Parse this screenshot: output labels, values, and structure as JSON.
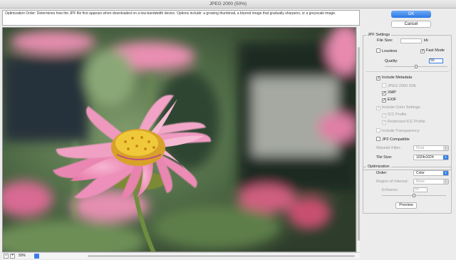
{
  "window": {
    "title": "JPEG 2000 (50%)"
  },
  "hint": "Optimization Order: Determines how the JPF file first appears when downloaded on a low-bandwidth device. Options include: a growing thumbnail, a blurred image that gradually sharpens, or a greyscale image.",
  "preview": {
    "image_description_icon": "flower-photo-icon"
  },
  "bottombar": {
    "zoom_out": "−",
    "zoom_in": "+",
    "zoom": "50%"
  },
  "buttons": {
    "ok": "OK",
    "cancel": "Cancel",
    "preview": "Preview"
  },
  "jpf": {
    "legend": "JPF Settings",
    "file_size_label": "File Size:",
    "file_size_unit": "kb",
    "file_size_value": "",
    "lossless": {
      "label": "Lossless",
      "checked": false
    },
    "fast_mode": {
      "label": "Fast Mode",
      "checked": true
    },
    "quality_label": "Quality:",
    "quality_value": "50",
    "quality_fraction": 0.5,
    "include_metadata": {
      "label": "Include Metadata",
      "checked": true
    },
    "jpeg2000_xml": {
      "label": "JPEG 2000 XML",
      "checked": false
    },
    "xmp": {
      "label": "XMP",
      "checked": true
    },
    "exif": {
      "label": "EXIF",
      "checked": true
    },
    "include_color": {
      "label": "Include Color Settings",
      "checked": true
    },
    "icc_profile": {
      "label": "ICC Profile",
      "checked": true
    },
    "restricted_icc": {
      "label": "Restricted ICC Profile",
      "checked": true
    },
    "include_transparency": {
      "label": "Include Transparency",
      "checked": false
    },
    "jp2_compatible": {
      "label": "JP2 Compatible",
      "checked": false
    },
    "wavelet_label": "Wavelet Filter:",
    "wavelet_value": "Float",
    "tile_label": "Tile Size:",
    "tile_value": "1024x1024"
  },
  "optimization": {
    "legend": "Optimization",
    "order_label": "Order:",
    "order_value": "Color",
    "roi_label": "Region of Interest:",
    "roi_value": "None",
    "enhance_label": "Enhance:",
    "enhance_value": "50",
    "enhance_fraction": 0.5
  },
  "colors": {
    "accent": "#3a7fe4",
    "petal": "#f08db7",
    "center": "#e8b62a"
  }
}
